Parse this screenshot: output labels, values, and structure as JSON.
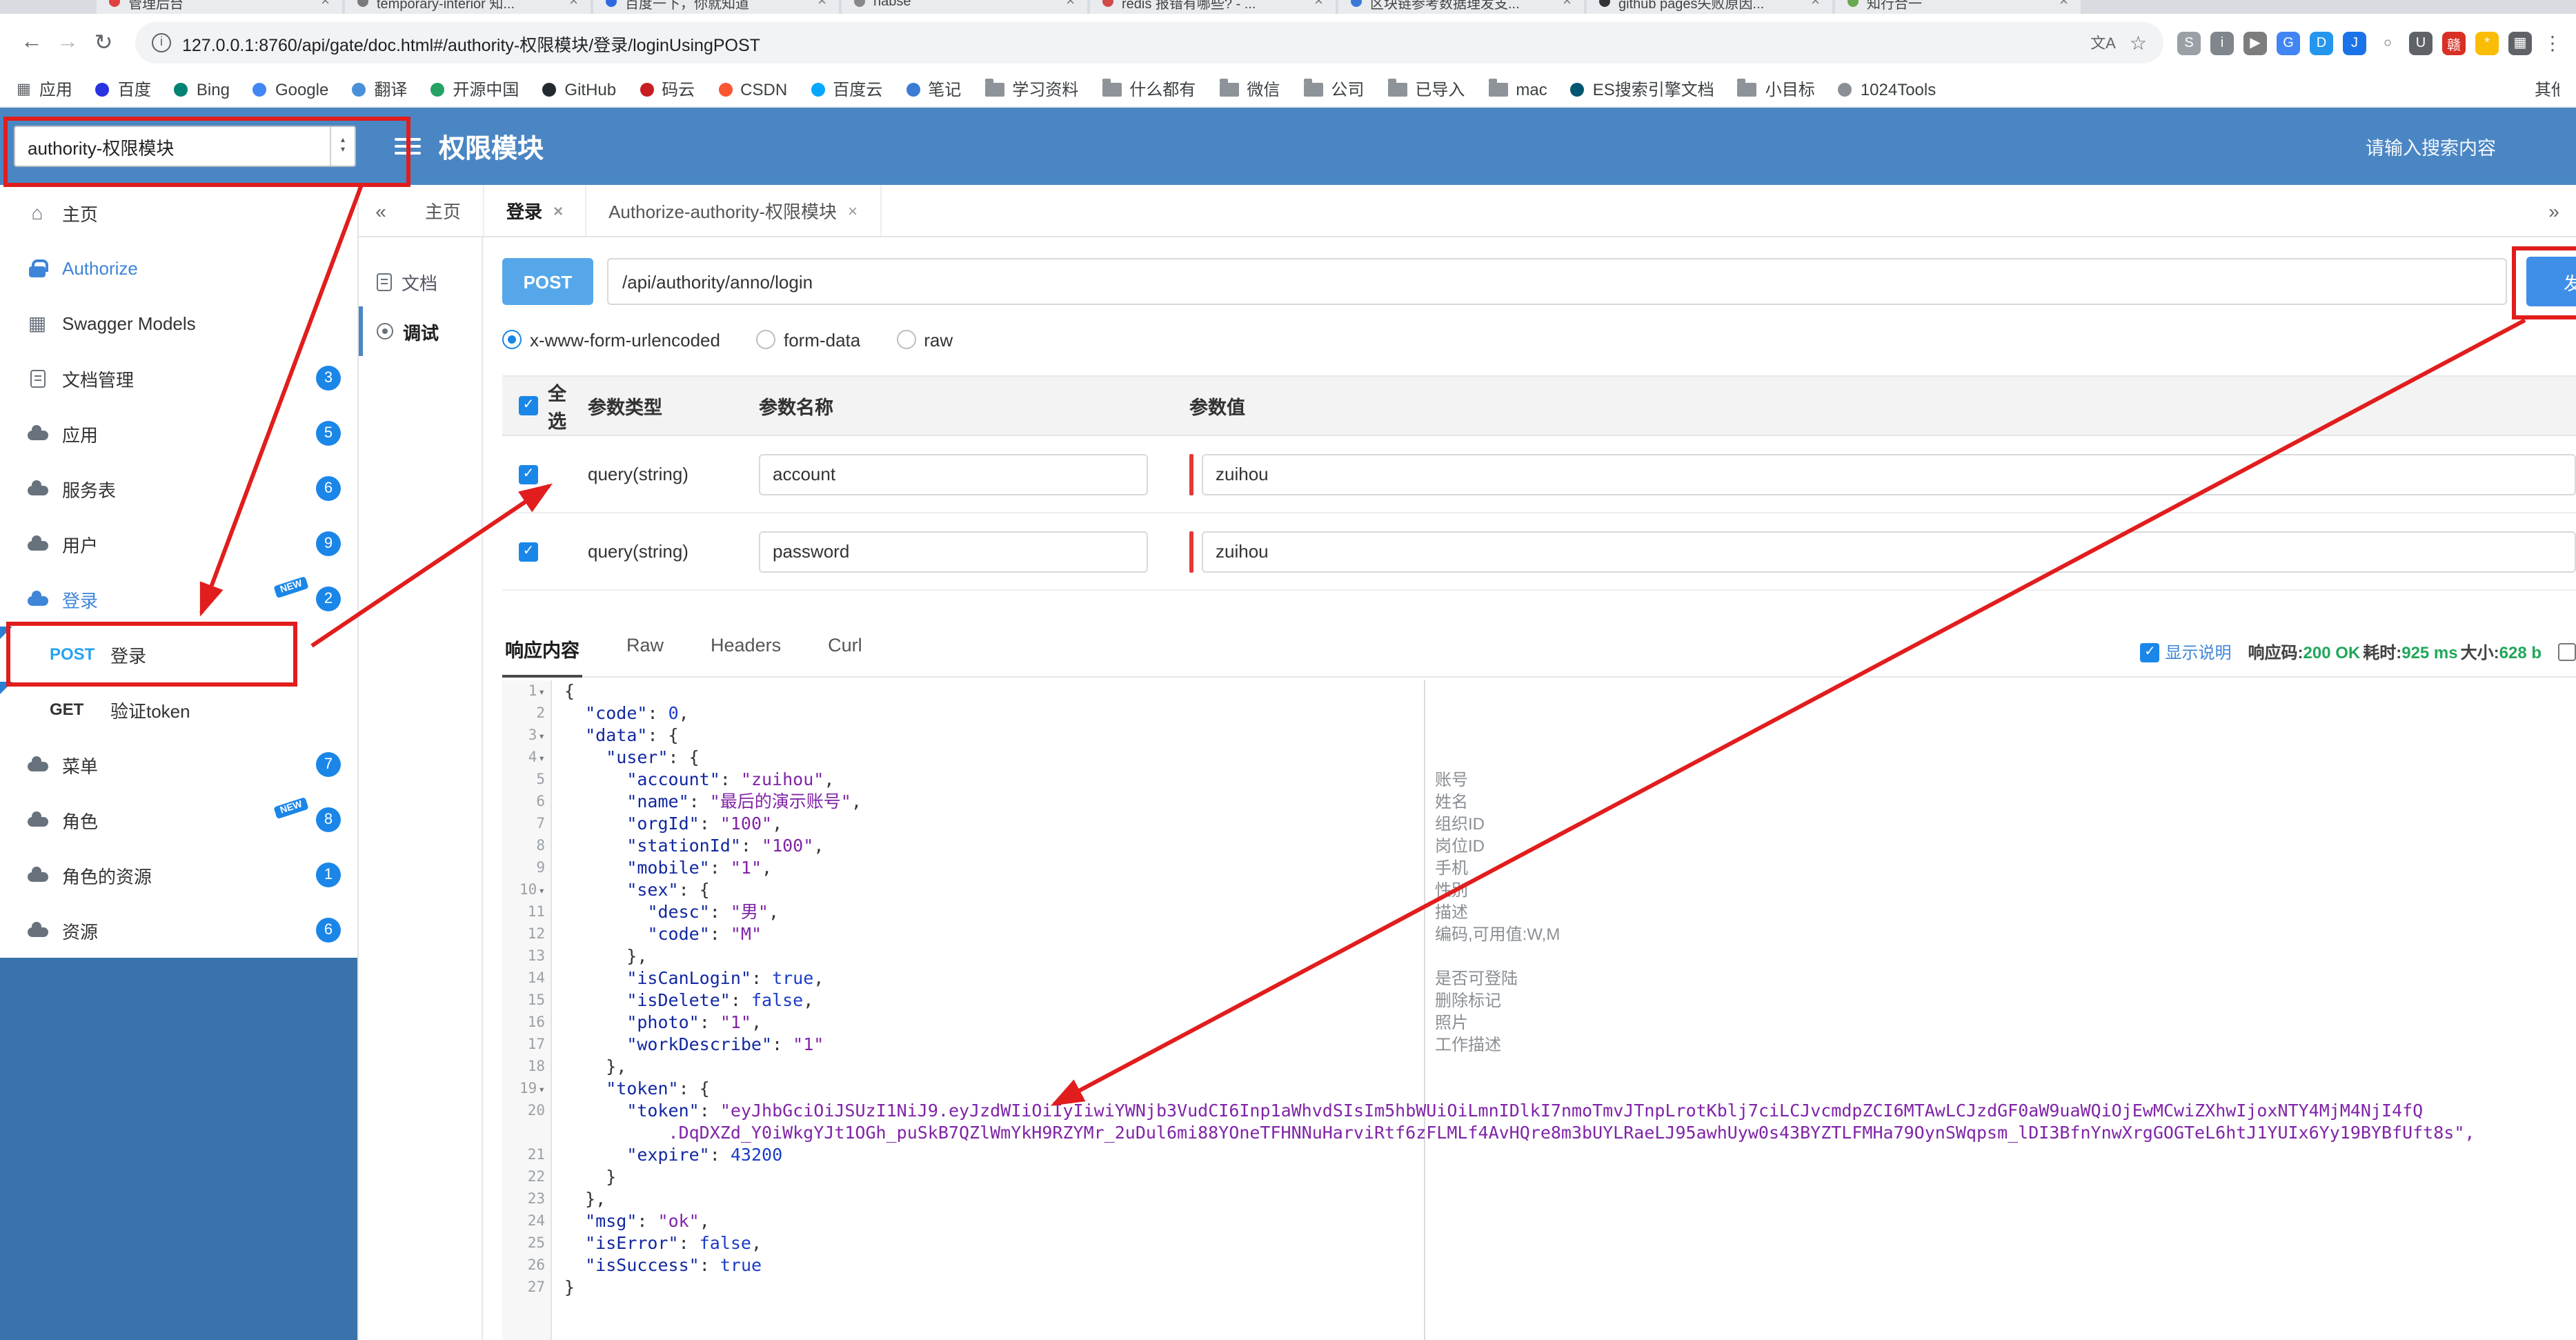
{
  "icons": {
    "back": "←",
    "forward": "→",
    "reload": "↻",
    "info": "i",
    "translate": "文A",
    "star": "☆",
    "more": "⋮",
    "apps": "▦",
    "collapse": "«",
    "expand": "»",
    "close": "×",
    "check": "✓",
    "caret_up": "▴",
    "caret_down": "▾",
    "home": "⌂",
    "models": "▦",
    "fold": "▾"
  },
  "browser": {
    "url": "127.0.0.1:8760/api/gate/doc.html#/authority-权限模块/登录/loginUsingPOST",
    "tabs": [
      {
        "title": "管理后台",
        "color": "#e04040"
      },
      {
        "title": "temporary-interior 知...",
        "color": "#7a7a7a"
      },
      {
        "title": "百度一下，你就知道",
        "color": "#2d6ae0"
      },
      {
        "title": "habse",
        "color": "#888888"
      },
      {
        "title": "redis 报错有哪些? - ...",
        "color": "#d04b4b"
      },
      {
        "title": "区块链参考数据理发支...",
        "color": "#3c78d8"
      },
      {
        "title": "github pages失败原因...",
        "color": "#333333"
      },
      {
        "title": "知行合一",
        "color": "#6aa84f"
      }
    ],
    "extensions": [
      {
        "name": "screenshot-extension-icon",
        "glyph": "S",
        "bg": "#9aa0a6"
      },
      {
        "name": "info-extension-icon",
        "glyph": "i",
        "bg": "#80868b"
      },
      {
        "name": "selector-extension-icon",
        "glyph": "▶",
        "bg": "#7d7d7d"
      },
      {
        "name": "google-extension-icon",
        "glyph": "G",
        "bg": "#4285f4"
      },
      {
        "name": "docker-extension-icon",
        "glyph": "D",
        "bg": "#2496ed"
      },
      {
        "name": "jpg-extension-icon",
        "glyph": "J",
        "bg": "#1a73e8"
      },
      {
        "name": "ring-extension-icon",
        "glyph": "○",
        "bg": "#ffffff",
        "fg": "#666666"
      },
      {
        "name": "shield-extension-icon",
        "glyph": "U",
        "bg": "#5f6368"
      },
      {
        "name": "hanzi-extension-icon",
        "glyph": "赣",
        "bg": "#d93025"
      },
      {
        "name": "star-extension-icon",
        "glyph": "*",
        "bg": "#fbbc04"
      },
      {
        "name": "grid-extension-icon",
        "glyph": "▦",
        "bg": "#5f6368"
      }
    ],
    "bookmarks": [
      {
        "label": "应用",
        "icon": "apps"
      },
      {
        "label": "百度",
        "icon": "dot",
        "color": "#2932e1"
      },
      {
        "label": "Bing",
        "icon": "dot",
        "color": "#008373"
      },
      {
        "label": "Google",
        "icon": "dot",
        "color": "#4285f4"
      },
      {
        "label": "翻译",
        "icon": "dot",
        "color": "#4a90d9"
      },
      {
        "label": "开源中国",
        "icon": "dot",
        "color": "#24a263"
      },
      {
        "label": "GitHub",
        "icon": "dot",
        "color": "#24292e"
      },
      {
        "label": "码云",
        "icon": "dot",
        "color": "#c71d23"
      },
      {
        "label": "CSDN",
        "icon": "dot",
        "color": "#fc5531"
      },
      {
        "label": "百度云",
        "icon": "dot",
        "color": "#06a7ff"
      },
      {
        "label": "笔记",
        "icon": "dot",
        "color": "#3a7bd5"
      },
      {
        "label": "学习资料",
        "icon": "folder"
      },
      {
        "label": "什么都有",
        "icon": "folder"
      },
      {
        "label": "微信",
        "icon": "folder"
      },
      {
        "label": "公司",
        "icon": "folder"
      },
      {
        "label": "已导入",
        "icon": "folder"
      },
      {
        "label": "mac",
        "icon": "folder"
      },
      {
        "label": "ES搜索引擎文档",
        "icon": "dot",
        "color": "#005571"
      },
      {
        "label": "小目标",
        "icon": "folder"
      },
      {
        "label": "1024Tools",
        "icon": "dot",
        "color": "#8a8f94"
      },
      {
        "label": "其他书签",
        "icon": "none",
        "overflow": true
      }
    ]
  },
  "header": {
    "project_select": "authority-权限模块",
    "title": "权限模块",
    "search_placeholder": "请输入搜索内容"
  },
  "sidebar": {
    "items": [
      {
        "label": "主页",
        "icon": "home"
      },
      {
        "label": "Authorize",
        "icon": "lock",
        "accent": true
      },
      {
        "label": "Swagger Models",
        "icon": "models"
      },
      {
        "label": "文档管理",
        "icon": "doc",
        "badge": "3"
      },
      {
        "label": "应用",
        "icon": "cloud",
        "badge": "5"
      },
      {
        "label": "服务表",
        "icon": "cloud",
        "badge": "6"
      },
      {
        "label": "用户",
        "icon": "cloud",
        "badge": "9"
      },
      {
        "label": "登录",
        "icon": "cloud",
        "badge": "2",
        "isNew": true,
        "accent": true
      },
      {
        "label": "登录",
        "method": "POST",
        "child": true
      },
      {
        "label": "验证token",
        "method": "GET",
        "child": true
      },
      {
        "label": "菜单",
        "icon": "cloud",
        "badge": "7"
      },
      {
        "label": "角色",
        "icon": "cloud",
        "badge": "8",
        "isNew": true
      },
      {
        "label": "角色的资源",
        "icon": "cloud",
        "badge": "1"
      },
      {
        "label": "资源",
        "icon": "cloud",
        "badge": "6"
      }
    ]
  },
  "tabs": {
    "items": [
      {
        "label": "主页",
        "closable": false
      },
      {
        "label": "登录",
        "closable": true,
        "active": true
      },
      {
        "label": "Authorize-authority-权限模块",
        "closable": true
      }
    ]
  },
  "doc_nav": {
    "items": [
      {
        "label": "文档",
        "icon": "doc"
      },
      {
        "label": "调试",
        "icon": "debug",
        "active": true
      }
    ]
  },
  "debug": {
    "method": "POST",
    "url": "/api/authority/anno/login",
    "send_label": "发送",
    "content_types": [
      {
        "label": "x-www-form-urlencoded",
        "checked": true
      },
      {
        "label": "form-data",
        "checked": false
      },
      {
        "label": "raw",
        "checked": false
      }
    ],
    "params_table": {
      "headers": [
        "全选",
        "参数类型",
        "参数名称",
        "参数值"
      ],
      "rows": [
        {
          "checked": true,
          "type": "query(string)",
          "name": "account",
          "value": "zuihou"
        },
        {
          "checked": true,
          "type": "query(string)",
          "name": "password",
          "value": "zuihou"
        }
      ]
    },
    "response_tabs": [
      {
        "label": "响应内容",
        "active": true
      },
      {
        "label": "Raw",
        "active": false
      },
      {
        "label": "Headers",
        "active": false
      },
      {
        "label": "Curl",
        "active": false
      }
    ],
    "show_desc_label": "显示说明",
    "status": {
      "code_label": "响应码:",
      "code": "200 OK",
      "time_label": "耗时:",
      "time": "925 ms",
      "size_label": "大小:",
      "size": "628 b"
    }
  },
  "editor": {
    "lines": [
      {
        "n": "1",
        "fold": true,
        "text": "{"
      },
      {
        "n": "2",
        "text": "  \"code\": 0,"
      },
      {
        "n": "3",
        "fold": true,
        "text": "  \"data\": {"
      },
      {
        "n": "4",
        "fold": true,
        "text": "    \"user\": {"
      },
      {
        "n": "5",
        "text": "      \"account\": \"zuihou\",",
        "note": "账号"
      },
      {
        "n": "6",
        "text": "      \"name\": \"最后的演示账号\",",
        "note": "姓名"
      },
      {
        "n": "7",
        "text": "      \"orgId\": \"100\",",
        "note": "组织ID"
      },
      {
        "n": "8",
        "text": "      \"stationId\": \"100\",",
        "note": "岗位ID"
      },
      {
        "n": "9",
        "text": "      \"mobile\": \"1\",",
        "note": "手机"
      },
      {
        "n": "10",
        "fold": true,
        "text": "      \"sex\": {",
        "note": "性别"
      },
      {
        "n": "11",
        "text": "        \"desc\": \"男\",",
        "note": "描述"
      },
      {
        "n": "12",
        "text": "        \"code\": \"M\"",
        "note": "编码,可用值:W,M"
      },
      {
        "n": "13",
        "text": "      },"
      },
      {
        "n": "14",
        "text": "      \"isCanLogin\": true,",
        "note": "是否可登陆"
      },
      {
        "n": "15",
        "text": "      \"isDelete\": false,",
        "note": "删除标记"
      },
      {
        "n": "16",
        "text": "      \"photo\": \"1\",",
        "note": "照片"
      },
      {
        "n": "17",
        "text": "      \"workDescribe\": \"1\"",
        "note": "工作描述"
      },
      {
        "n": "18",
        "text": "    },"
      },
      {
        "n": "19",
        "fold": true,
        "text": "    \"token\": {"
      },
      {
        "n": "20",
        "text": "      \"token\": \"eyJhbGciOiJSUzI1NiJ9.eyJzdWIiOiIyIiwiYWNjb3VudCI6Inp1aWhvdSIsIm5hbWUiOiLmnIDlkI7nmoTmvJTnpLrotKblj7ciLCJvcmdpZCI6MTAwLCJzdGF0aW9uaWQiOjEwMCwiZXhwIjoxNTY4MjM4NjI4fQ"
      },
      {
        "n": "",
        "cont": true,
        "text": "          .DqDXZd_Y0iWkgYJt1OGh_puSkB7QZlWmYkH9RZYMr_2uDul6mi88YOneTFHNNuHarviRtf6zFLMLf4AvHQre8m3bUYLRaeLJ95awhUyw0s43BYZTLFMHa79OynSWqpsm_lDI3BfnYnwXrgGOGTeL6htJ1YUIx6Yy19BYBfUft8s\","
      },
      {
        "n": "21",
        "text": "      \"expire\": 43200"
      },
      {
        "n": "22",
        "text": "    }"
      },
      {
        "n": "23",
        "text": "  },"
      },
      {
        "n": "24",
        "text": "  \"msg\": \"ok\","
      },
      {
        "n": "25",
        "text": "  \"isError\": false,"
      },
      {
        "n": "26",
        "text": "  \"isSuccess\": true"
      },
      {
        "n": "27",
        "text": "}"
      }
    ]
  }
}
